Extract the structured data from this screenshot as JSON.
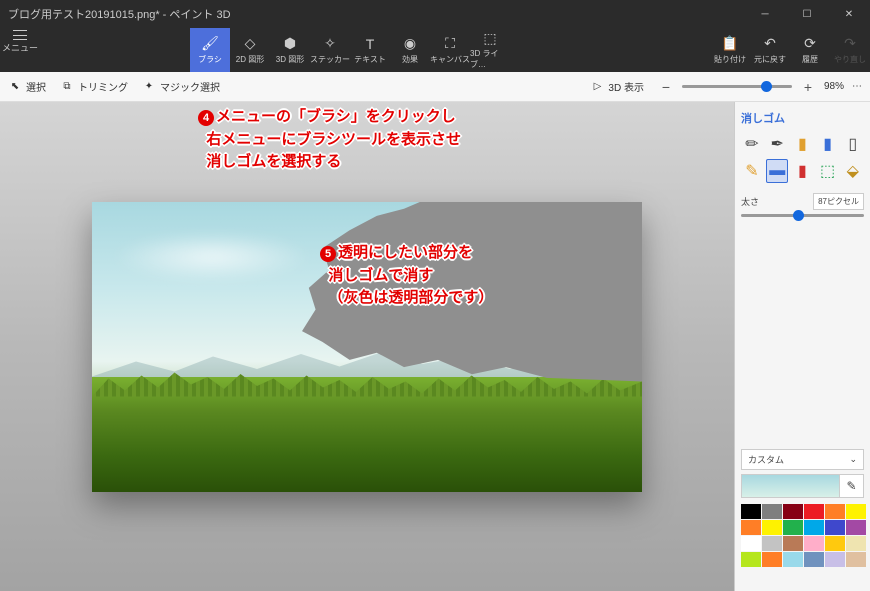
{
  "titlebar": {
    "title": "ブログ用テスト20191015.png* - ペイント 3D"
  },
  "menu": {
    "label": "メニュー"
  },
  "toolbar": {
    "brush": "ブラシ",
    "shapes2d": "2D 図形",
    "shapes3d": "3D 図形",
    "sticker": "ステッカー",
    "text": "テキスト",
    "effects": "効果",
    "canvas": "キャンバス",
    "lib3d": "3D ライブ…",
    "paste": "貼り付け",
    "undo": "元に戻す",
    "history": "履歴",
    "redo": "やり直し"
  },
  "subtoolbar": {
    "select": "選択",
    "trim": "トリミング",
    "magic": "マジック選択",
    "view3d": "3D 表示",
    "zoom": "98%"
  },
  "sidebar": {
    "title": "消しゴム",
    "thickness_label": "太さ",
    "thickness_value": "87ピクセル",
    "custom": "カスタム"
  },
  "palette": [
    "#000000",
    "#7f7f7f",
    "#870014",
    "#ec1c23",
    "#ff7e26",
    "#fef200",
    "#ff7e26",
    "#fef200",
    "#22b14c",
    "#00a8e8",
    "#3f48cc",
    "#a349a4",
    "#ffffff",
    "#c3c3c3",
    "#b97a57",
    "#ffaec9",
    "#ffc90e",
    "#efe4b0",
    "#b5e61d",
    "#ff7e26",
    "#99d9ea",
    "#7092be",
    "#c8bfe7",
    "#e0c0a0"
  ],
  "annotations": {
    "num4": "4",
    "line4_1": "メニューの「ブラシ」をクリックし",
    "line4_2": "右メニューにブラシツールを表示させ",
    "line4_3": "消しゴムを選択する",
    "num5": "5",
    "line5_1": "透明にしたい部分を",
    "line5_2": "消しゴムで消す",
    "line5_3": "（灰色は透明部分です）"
  }
}
